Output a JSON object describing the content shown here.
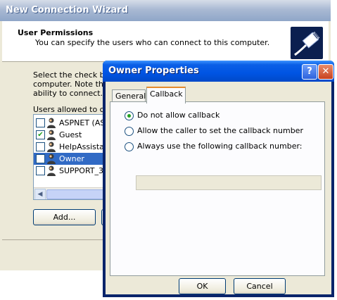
{
  "wizard": {
    "title": "New Connection Wizard",
    "header_title": "User Permissions",
    "header_subtitle": "You can specify the users who can connect to this computer.",
    "description_lines": [
      "Select the check box",
      "computer.  Note that",
      "ability to connect."
    ],
    "users_label": "Users allowed to conn",
    "users": [
      {
        "name": "ASPNET (AS",
        "checked": false,
        "selected": false
      },
      {
        "name": "Guest",
        "checked": true,
        "selected": false
      },
      {
        "name": "HelpAssistan",
        "checked": false,
        "selected": false
      },
      {
        "name": "Owner",
        "checked": false,
        "selected": true
      },
      {
        "name": "SUPPORT_3",
        "checked": false,
        "selected": false
      }
    ],
    "add_button": "Add...",
    "logo_icon": "network-cable-icon"
  },
  "dialog": {
    "title": "Owner Properties",
    "help_label": "?",
    "close_label": "✕",
    "tabs": [
      "General",
      "Callback"
    ],
    "active_tab": "Callback",
    "options": [
      {
        "label": "Do not allow callback",
        "selected": true
      },
      {
        "label": "Allow the caller to set the callback number",
        "selected": false
      },
      {
        "label": "Always use the following callback number:",
        "selected": false
      }
    ],
    "callback_number": "",
    "ok_label": "OK",
    "cancel_label": "Cancel"
  },
  "colors": {
    "title_active": "#0054e3",
    "title_inactive": "#a9b9d3",
    "selection": "#316ac5",
    "face": "#ece9d8"
  }
}
